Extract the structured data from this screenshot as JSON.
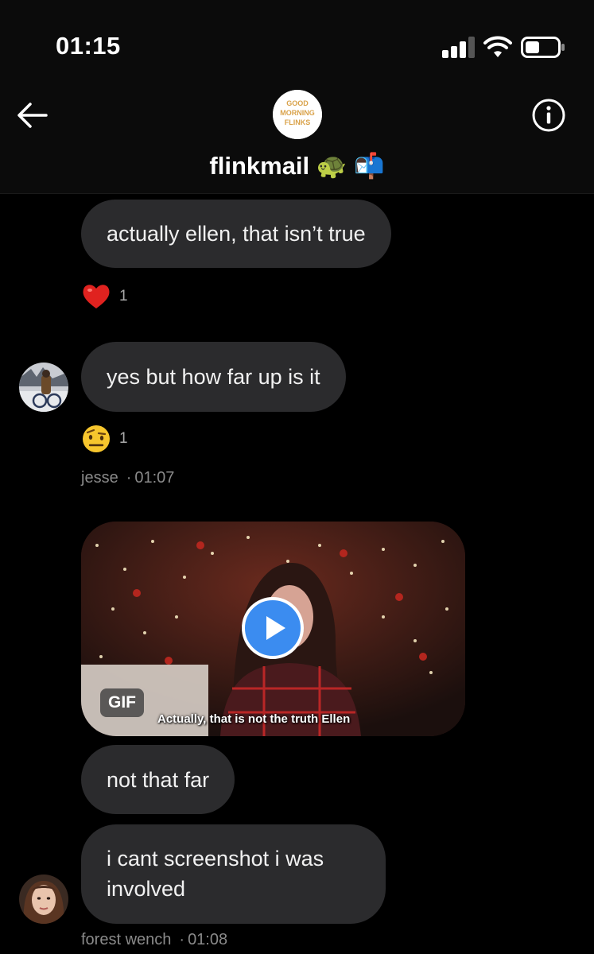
{
  "status_bar": {
    "time": "01:15"
  },
  "header": {
    "group_name": "flinkmail 🐢 📬",
    "avatar_text": "GOOD MORNING FLINKS"
  },
  "messages": [
    {
      "text": "actually ellen, that isn’t true",
      "reaction": {
        "emoji": "heart-emoji",
        "count": "1"
      }
    },
    {
      "text": "yes but how far up is it",
      "reaction": {
        "emoji": "raised-eyebrow-emoji",
        "count": "1"
      },
      "sender": "jesse",
      "time": "01:07"
    },
    {
      "gif": {
        "badge": "GIF",
        "caption": "Actually, that is not the truth Ellen"
      }
    },
    {
      "text": "not that far"
    },
    {
      "text": "i cant screenshot i was involved",
      "sender": "forest wench",
      "time": "01:08"
    }
  ]
}
